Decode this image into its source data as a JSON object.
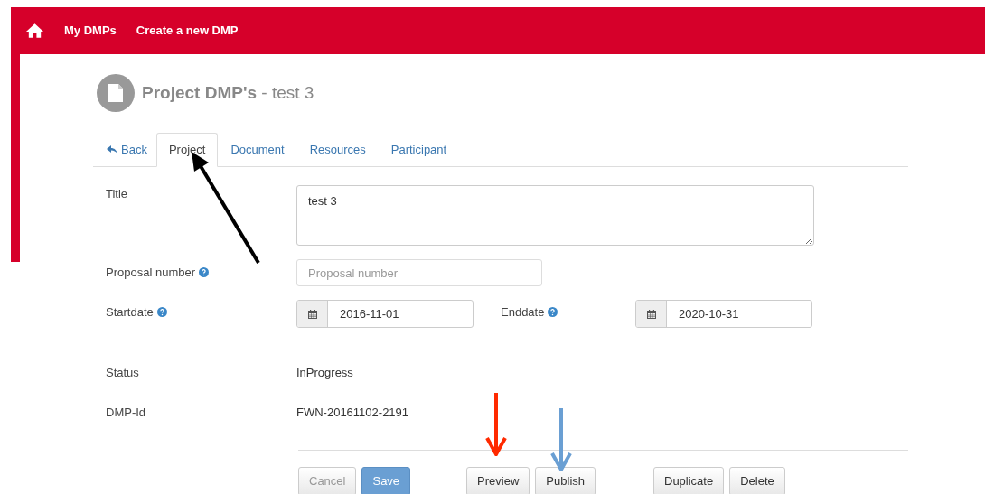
{
  "navbar": {
    "items": [
      {
        "label": "My DMPs"
      },
      {
        "label": "Create a new DMP"
      }
    ]
  },
  "page_title": {
    "main": "Project DMP's",
    "sub": "- test 3"
  },
  "tabs": [
    {
      "label": "Back",
      "kind": "back",
      "selected": false
    },
    {
      "label": "Project",
      "kind": "tab",
      "selected": true
    },
    {
      "label": "Document",
      "kind": "tab",
      "selected": false
    },
    {
      "label": "Resources",
      "kind": "tab",
      "selected": false
    },
    {
      "label": "Participant",
      "kind": "tab",
      "selected": false
    }
  ],
  "form": {
    "title": {
      "label": "Title",
      "value": "test 3"
    },
    "proposal_number": {
      "label": "Proposal number",
      "placeholder": "Proposal number"
    },
    "startdate": {
      "label": "Startdate",
      "value": "2016-11-01"
    },
    "enddate": {
      "label": "Enddate",
      "value": "2020-10-31"
    },
    "status": {
      "label": "Status",
      "value": "InProgress"
    },
    "dmp_id": {
      "label": "DMP-Id",
      "value": "FWN-20161102-2191"
    }
  },
  "button_groups": [
    [
      {
        "label": "Cancel",
        "kind": "default",
        "disabled": true
      },
      {
        "label": "Save",
        "kind": "primary",
        "disabled": false
      }
    ],
    [
      {
        "label": "Preview",
        "kind": "default",
        "disabled": false
      },
      {
        "label": "Publish",
        "kind": "default",
        "disabled": false
      }
    ],
    [
      {
        "label": "Duplicate",
        "kind": "default",
        "disabled": false
      },
      {
        "label": "Delete",
        "kind": "default",
        "disabled": false
      }
    ]
  ]
}
